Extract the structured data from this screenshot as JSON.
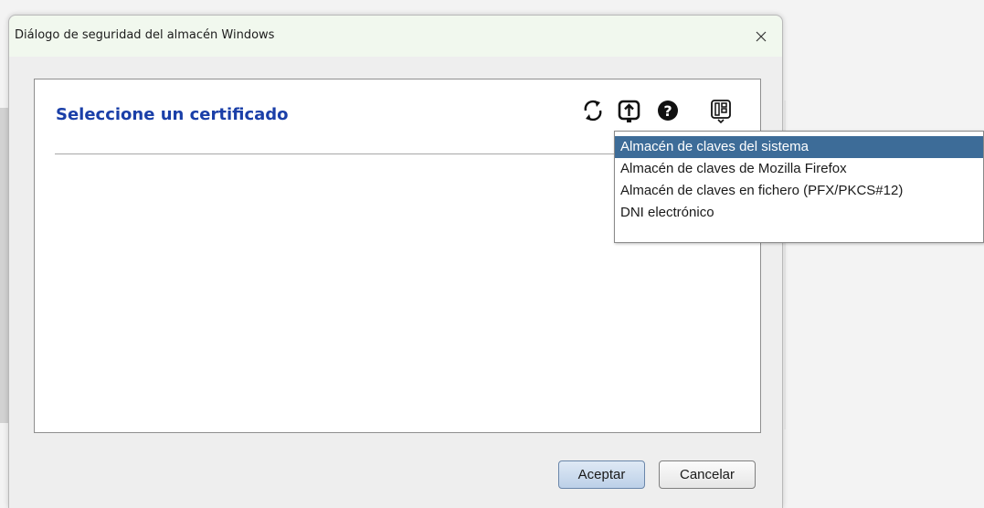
{
  "window": {
    "title": "Diálogo de seguridad del almacén Windows",
    "close_icon": "close-icon"
  },
  "panel": {
    "heading": "Seleccione un certificado",
    "toolbar": [
      {
        "icon": "refresh-icon"
      },
      {
        "icon": "export-icon"
      },
      {
        "icon": "help-icon"
      },
      {
        "icon": "keystore-selector-icon"
      }
    ]
  },
  "keystore_menu": {
    "items": [
      {
        "label": "Almacén de claves del sistema",
        "selected": true
      },
      {
        "label": "Almacén de claves de Mozilla Firefox",
        "selected": false
      },
      {
        "label": "Almacén de claves en fichero (PFX/PKCS#12)",
        "selected": false
      },
      {
        "label": "DNI electrónico",
        "selected": false
      }
    ]
  },
  "buttons": {
    "accept_label": "Aceptar",
    "cancel_label": "Cancelar"
  },
  "colors": {
    "heading": "#1a3fa8",
    "menu_selected": "#3d6c98"
  }
}
